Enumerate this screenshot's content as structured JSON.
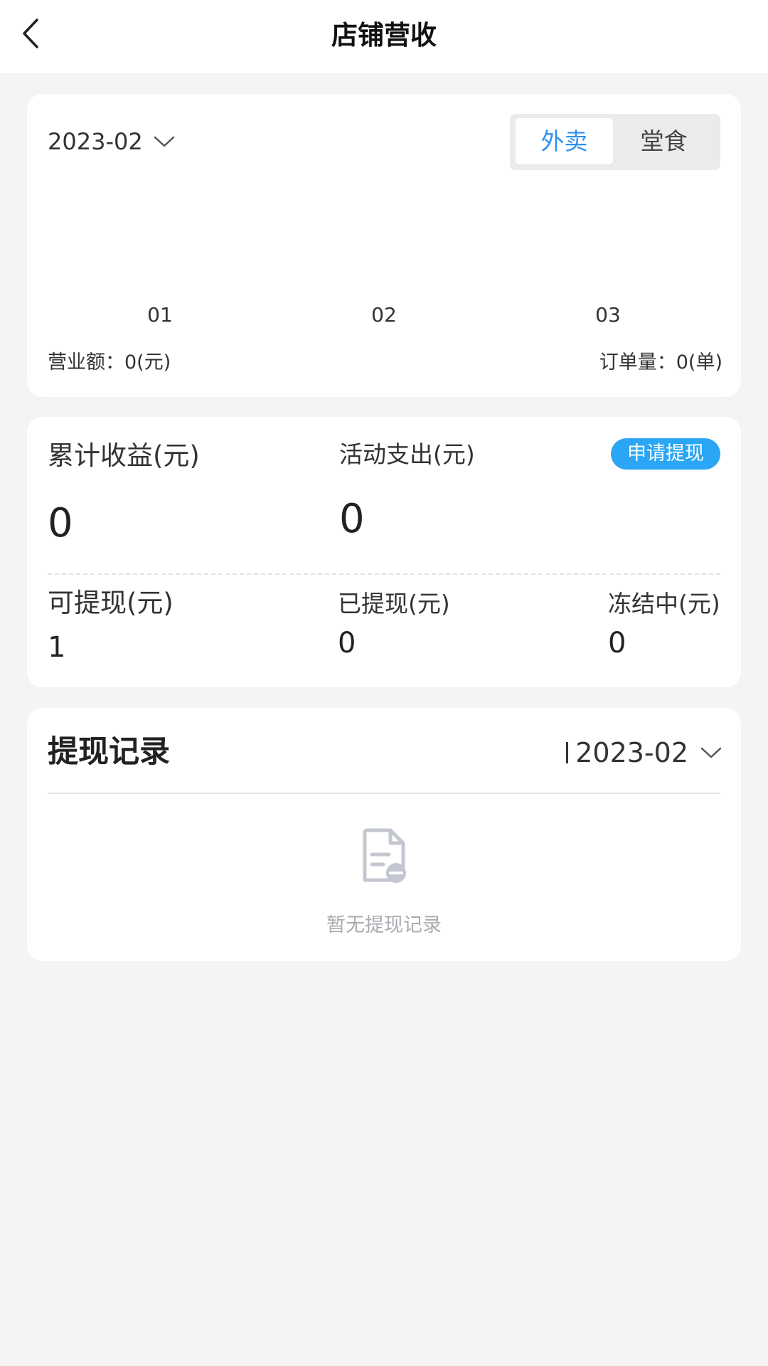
{
  "header": {
    "title": "店铺营收"
  },
  "revenue_card": {
    "month": "2023-02",
    "tabs": [
      {
        "label": "外卖",
        "active": true
      },
      {
        "label": "堂食",
        "active": false
      }
    ],
    "x_labels": [
      "01",
      "02",
      "03"
    ],
    "turnover_text": "营业额：0(元)",
    "orders_text": "订单量：0(单)"
  },
  "earnings_card": {
    "cumulative_label": "累计收益(元)",
    "cumulative_value": "0",
    "activity_label": "活动支出(元)",
    "activity_value": "0",
    "apply_button": "申请提现",
    "withdrawable_label": "可提现(元)",
    "withdrawable_value": "1",
    "withdrawn_label": "已提现(元)",
    "withdrawn_value": "0",
    "frozen_label": "冻结中(元)",
    "frozen_value": "0"
  },
  "records_card": {
    "title": "提现记录",
    "month": "2023-02",
    "empty_text": "暂无提现记录"
  },
  "colors": {
    "accent": "#2f8ff0",
    "apply_button": "#2aa6f5",
    "background": "#f4f4f5",
    "muted_text": "#a9abb0"
  },
  "icons": {
    "back": "chevron-left-icon",
    "dropdown": "chevron-down-icon",
    "empty": "document-remove-icon"
  }
}
